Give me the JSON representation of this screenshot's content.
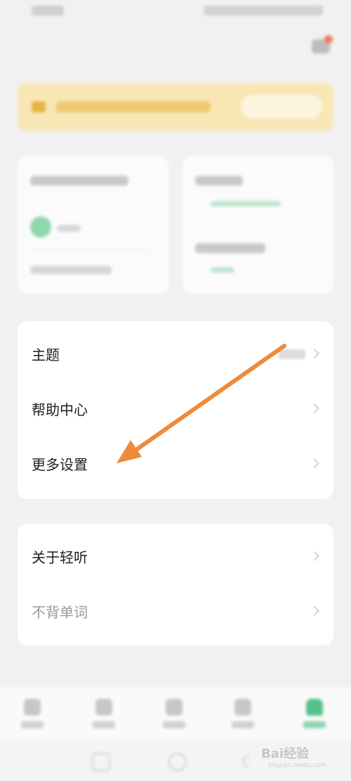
{
  "menu_group_1": [
    {
      "label": "主题"
    },
    {
      "label": "帮助中心"
    },
    {
      "label": "更多设置"
    }
  ],
  "menu_group_2": [
    {
      "label": "关于轻听"
    },
    {
      "label": "不背单词"
    }
  ],
  "watermark": {
    "brand": "Bai",
    "brand_suffix": "经验",
    "url": "jingyan.baidu.com"
  },
  "colors": {
    "accent": "#55c08a",
    "banner_bg": "#f9e6b5",
    "arrow": "#ee8b3a",
    "notification_dot": "#f07a63"
  }
}
